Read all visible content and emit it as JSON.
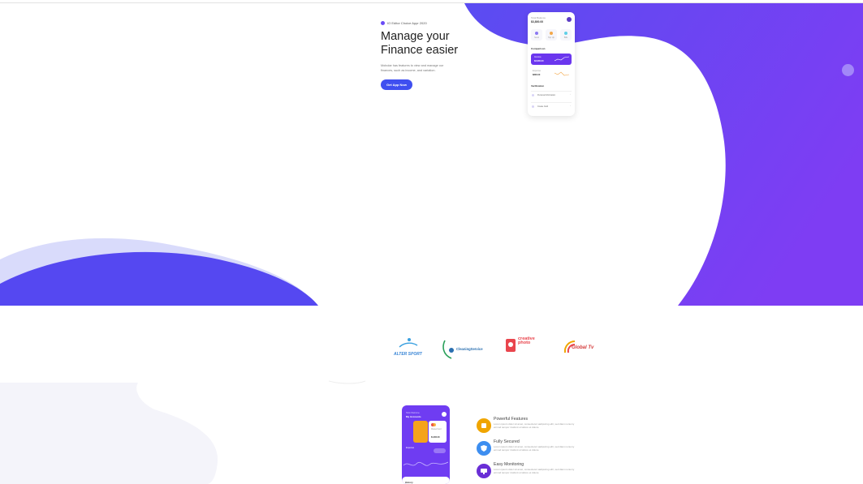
{
  "hero": {
    "badge": "IO Editor Choice Appr 2020",
    "title_line1": "Manage your",
    "title_line2": "Finance easier",
    "description": "Mobolar has features to view and manage our finances, such as income, and variation.",
    "cta_label": "Get App Now"
  },
  "phone_finance": {
    "balance_label": "Total Balance",
    "balance_value": "$3,800.00",
    "shortcuts": [
      "Send",
      "Top Up",
      "Bills"
    ],
    "comparison_label": "Comparison",
    "income_label": "Income",
    "income_value": "$3,600.00",
    "expense_label": "Expense",
    "expense_value": "$800.00",
    "verification_label": "Verification",
    "verif_items": [
      "Personal Information",
      "Create Card"
    ]
  },
  "logos": [
    {
      "name": "ALTER SPORT"
    },
    {
      "name": "CleaningService"
    },
    {
      "name_line1": "creative",
      "name_line2": "photo"
    },
    {
      "name": "Global Tv"
    }
  ],
  "phone_card": {
    "greeting": "Hello Welcome",
    "title": "My Accounts",
    "card_brand": "MasterCard",
    "card_value": "$1,800.00",
    "expense_label": "Expense",
    "history_label": "History"
  },
  "features": [
    {
      "title": "Powerful Features",
      "description": "Lorem ipsum dolor sit amet, consectetur sadipscing elitr, sed diam nonumy eirmod tempor invidunt ut labore et dolore",
      "color": "#f0a500",
      "icon": "cube-icon"
    },
    {
      "title": "Fully Secured",
      "description": "Lorem ipsum dolor sit amet, consectetur sadipscing elitr, sed diam nonumy eirmod tempor invidunt ut labore et dolore",
      "color": "#3d8ef0",
      "icon": "shield-icon"
    },
    {
      "title": "Easy Monitoring",
      "description": "Lorem ipsum dolor sit amet, consectetur sadipscing elitr, sed diam nonumy eirmod tempor invidunt ut labore et dolore",
      "color": "#6a2fd6",
      "icon": "monitor-icon"
    }
  ],
  "colors": {
    "primary": "#5b46f0",
    "purple": "#7b3af0",
    "cta": "#3f4ff0"
  }
}
